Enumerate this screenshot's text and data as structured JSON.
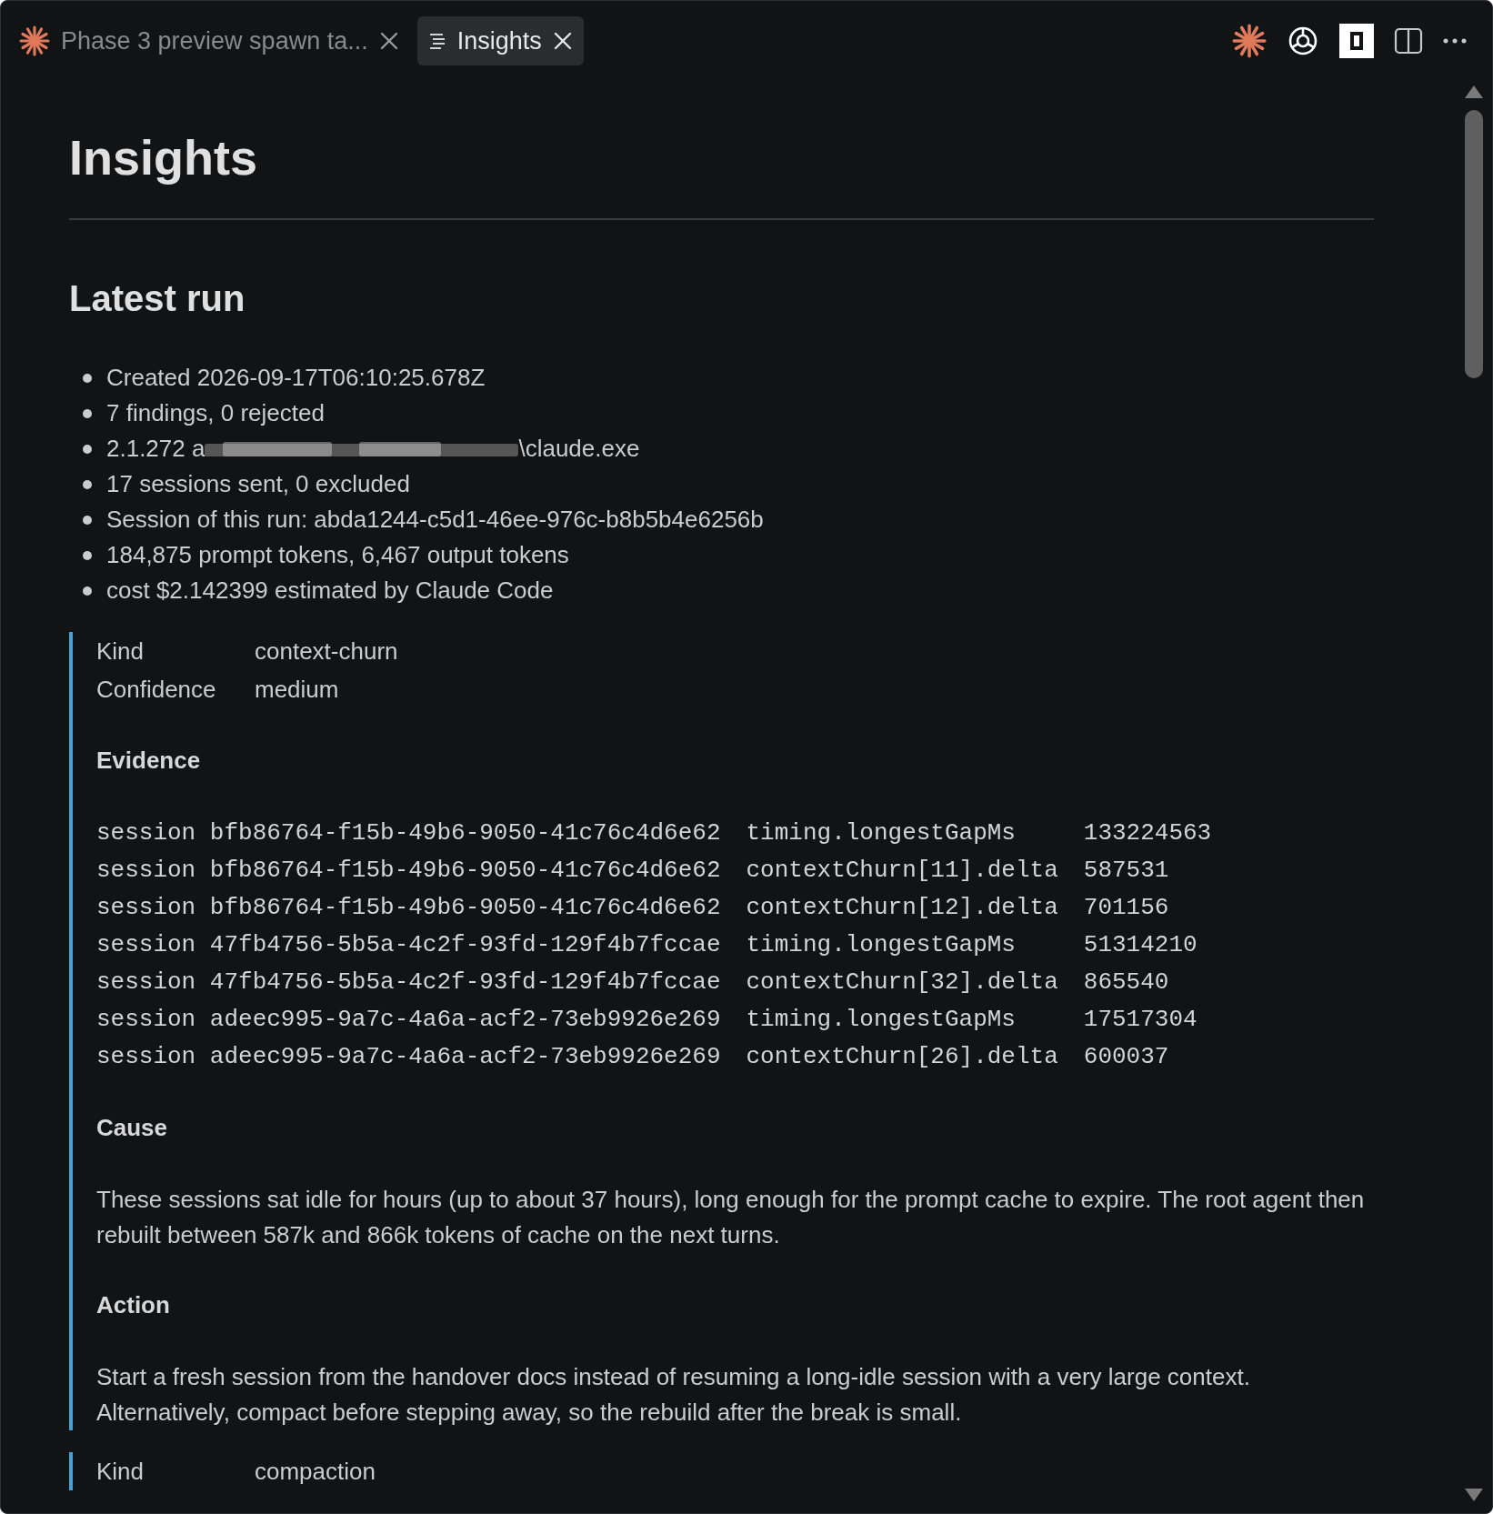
{
  "tabs": [
    {
      "label": "Phase 3 preview spawn ta...",
      "selected": false,
      "kind": "claude"
    },
    {
      "label": "Insights",
      "selected": true,
      "kind": "preview"
    }
  ],
  "document": {
    "title": "Insights",
    "section_heading": "Latest run",
    "bullets": [
      {
        "kind": "text",
        "text": "Created 2026-09-17T06:10:25.678Z"
      },
      {
        "kind": "text",
        "text": "7 findings, 0 rejected"
      },
      {
        "kind": "redacted",
        "prefix": "2.1.272 a",
        "suffix": "\\claude.exe"
      },
      {
        "kind": "text",
        "text": "17 sessions sent, 0 excluded"
      },
      {
        "kind": "text",
        "text": "Session of this run: abda1244-c5d1-46ee-976c-b8b5b4e6256b"
      },
      {
        "kind": "text",
        "text": "184,875 prompt tokens, 6,467 output tokens"
      },
      {
        "kind": "text",
        "text": "cost $2.142399 estimated by Claude Code"
      }
    ],
    "findings": [
      {
        "fields": [
          {
            "label": "Kind",
            "value": "context-churn"
          },
          {
            "label": "Confidence",
            "value": "medium"
          }
        ],
        "sections": [
          {
            "kind": "table",
            "heading": "Evidence",
            "rows": [
              [
                "session bfb86764-f15b-49b6-9050-41c76c4d6e62",
                "timing.longestGapMs",
                "133224563"
              ],
              [
                "session bfb86764-f15b-49b6-9050-41c76c4d6e62",
                "contextChurn[11].delta",
                "587531"
              ],
              [
                "session bfb86764-f15b-49b6-9050-41c76c4d6e62",
                "contextChurn[12].delta",
                "701156"
              ],
              [
                "session 47fb4756-5b5a-4c2f-93fd-129f4b7fccae",
                "timing.longestGapMs",
                "51314210"
              ],
              [
                "session 47fb4756-5b5a-4c2f-93fd-129f4b7fccae",
                "contextChurn[32].delta",
                "865540"
              ],
              [
                "session adeec995-9a7c-4a6a-acf2-73eb9926e269",
                "timing.longestGapMs",
                "17517304"
              ],
              [
                "session adeec995-9a7c-4a6a-acf2-73eb9926e269",
                "contextChurn[26].delta",
                "600037"
              ]
            ]
          },
          {
            "kind": "text",
            "heading": "Cause",
            "text": "These sessions sat idle for hours (up to about 37 hours), long enough for the prompt cache to expire. The root agent then rebuilt between 587k and 866k tokens of cache on the next turns."
          },
          {
            "kind": "text",
            "heading": "Action",
            "text": "Start a fresh session from the handover docs instead of resuming a long-idle session with a very large context. Alternatively, compact before stepping away, so the rebuild after the break is small."
          }
        ]
      },
      {
        "fields": [
          {
            "label": "Kind",
            "value": "compaction"
          }
        ]
      }
    ]
  }
}
